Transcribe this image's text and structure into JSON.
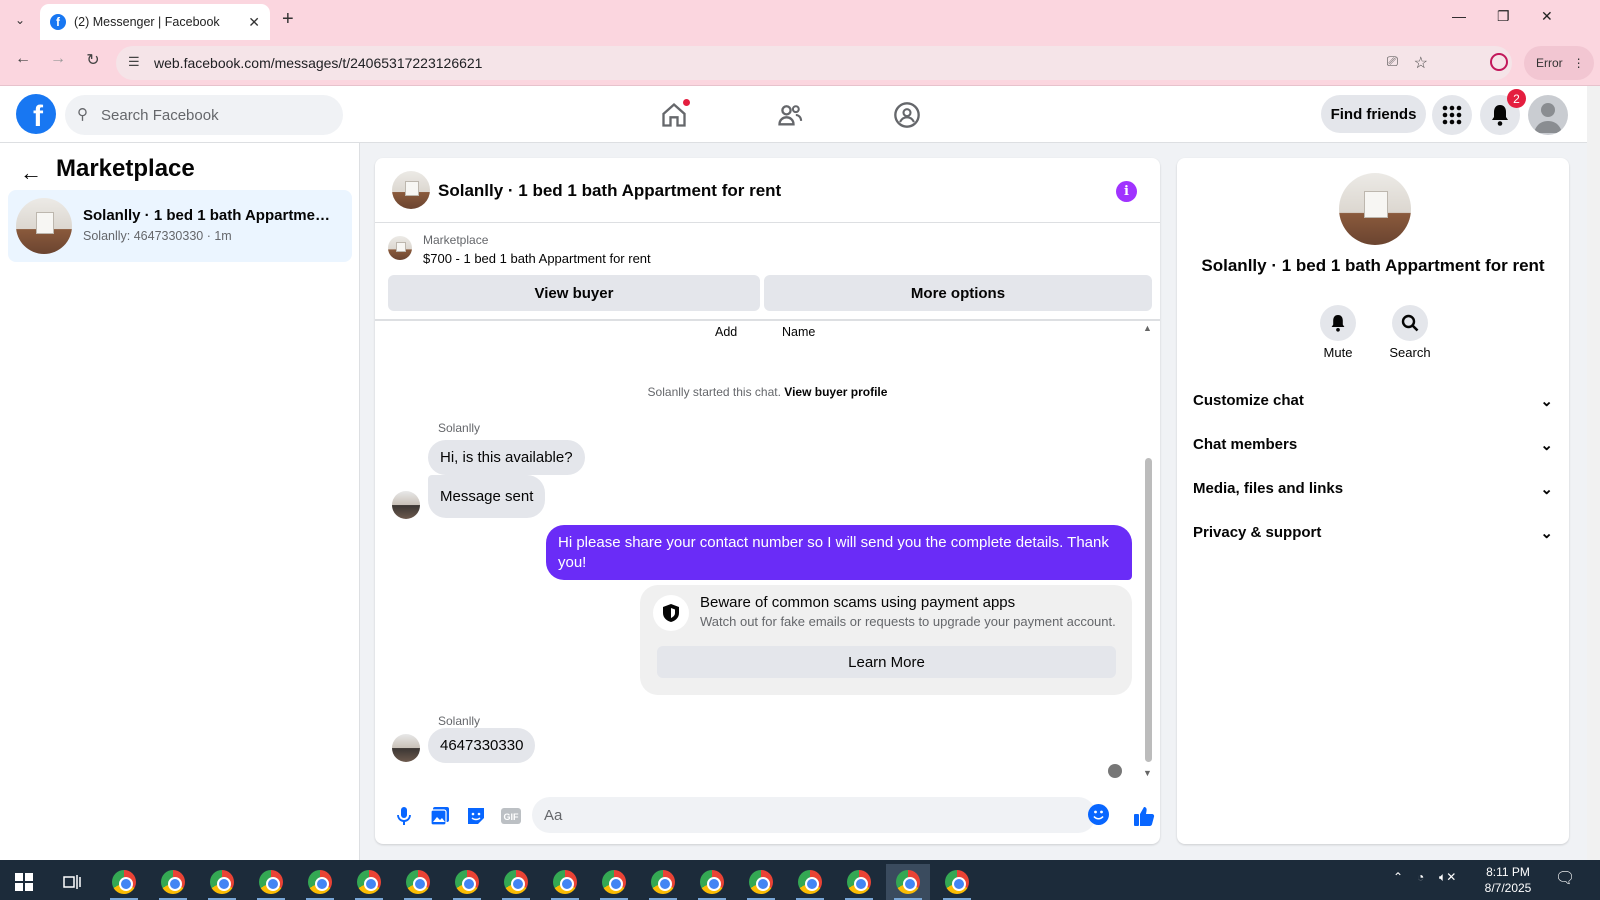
{
  "browser": {
    "tab_title": "(2) Messenger | Facebook",
    "url": "web.facebook.com/messages/t/24065317223126621",
    "error_label": "Error"
  },
  "header": {
    "search_placeholder": "Search Facebook",
    "find_friends": "Find friends",
    "notification_count": "2"
  },
  "sidebar": {
    "title": "Marketplace",
    "conversation": {
      "name": "Solanlly · 1 bed 1 bath Appartment...",
      "preview": "Solanlly: 4647330330 · 1m"
    }
  },
  "chat": {
    "title": "Solanlly · 1 bed 1 bath Appartment for rent",
    "marketplace_label": "Marketplace",
    "listing": "$700 - 1 bed 1 bath Appartment for rent",
    "view_buyer": "View buyer",
    "more_options": "More options",
    "add_label": "Add",
    "name_label": "Name",
    "system_text": "Solanlly started this chat.",
    "system_link": "View buyer profile",
    "messages": [
      {
        "sender": "Solanlly",
        "text": "Hi, is this available?"
      },
      {
        "text": "Message sent"
      },
      {
        "mine": true,
        "text": "Hi please share your contact number so I will send you the complete details. Thank you!"
      },
      {
        "sender": "Solanlly",
        "text": "4647330330"
      }
    ],
    "scam_card": {
      "title": "Beware of common scams using payment apps",
      "desc": "Watch out for fake emails or requests to upgrade your payment account.",
      "button": "Learn More"
    },
    "composer_placeholder": "Aa"
  },
  "details": {
    "title": "Solanlly · 1 bed 1 bath Appartment for rent",
    "mute": "Mute",
    "search": "Search",
    "sections": [
      "Customize chat",
      "Chat members",
      "Media, files and links",
      "Privacy & support"
    ]
  },
  "taskbar": {
    "time": "8:11 PM",
    "date": "8/7/2025"
  },
  "colors": {
    "facebook_blue": "#1877f2",
    "my_bubble": "#6a2cf7",
    "info_purple": "#a033ff",
    "chrome_pink": "#fbd6df"
  }
}
